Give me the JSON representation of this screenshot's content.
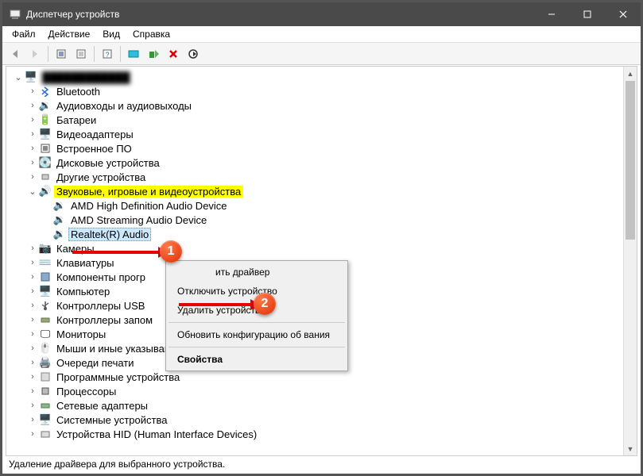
{
  "window": {
    "title": "Диспетчер устройств"
  },
  "menu": {
    "file": "Файл",
    "action": "Действие",
    "view": "Вид",
    "help": "Справка"
  },
  "tree": {
    "root": "",
    "bluetooth": "Bluetooth",
    "audio_io": "Аудиовходы и аудиовыходы",
    "batteries": "Батареи",
    "display_adapters": "Видеоадаптеры",
    "firmware": "Встроенное ПО",
    "disk_drives": "Дисковые устройства",
    "other_devices": "Другие устройства",
    "sound_game_video": "Звуковые, игровые и видеоустройства",
    "amd_hd_audio": "AMD High Definition Audio Device",
    "amd_streaming": "AMD Streaming Audio Device",
    "realtek": "Realtek(R) Audio",
    "cameras": "Камеры",
    "keyboards": "Клавиатуры",
    "software_components": "Компоненты прогр",
    "computer": "Компьютер",
    "usb_controllers": "Контроллеры USB",
    "memory_controllers": "Контроллеры запом",
    "monitors": "Мониторы",
    "mice": "Мыши и иные указывающие устройства",
    "print_queues": "Очереди печати",
    "software_devices": "Программные устройства",
    "processors": "Процессоры",
    "network_adapters": "Сетевые адаптеры",
    "system_devices": "Системные устройства",
    "hid": "Устройства HID (Human Interface Devices)"
  },
  "context_menu": {
    "update_driver": "ить драйвер",
    "disable_device": "Отключить устройство",
    "uninstall_device": "Удалить устройство",
    "scan_hardware": "Обновить конфигурацию об                вания",
    "properties": "Свойства"
  },
  "status": "Удаление драйвера для выбранного устройства.",
  "annotations": {
    "one": "1",
    "two": "2"
  }
}
